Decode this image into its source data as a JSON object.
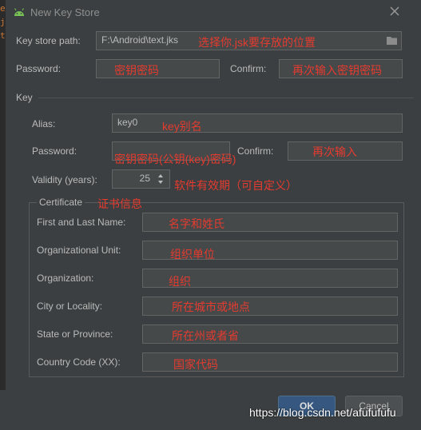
{
  "window": {
    "title": "New Key Store"
  },
  "editor": {
    "snippet": "e\nji\nt"
  },
  "keystore": {
    "path_label": "Key store path:",
    "path_value": "F:\\Android\\text.jks",
    "path_note": "选择你.jsk要存放的位置",
    "password_label": "Password:",
    "password_note": "密钥密码",
    "confirm_label": "Confirm:",
    "confirm_note": "再次输入密钥密码"
  },
  "key": {
    "section_label": "Key",
    "alias_label": "Alias:",
    "alias_value": "key0",
    "alias_note": "key别名",
    "password_label": "Password:",
    "password_note": "密钥密码(公钥(key)密码)",
    "confirm_label": "Confirm:",
    "confirm_note": "再次输入",
    "validity_label": "Validity (years):",
    "validity_value": "25",
    "validity_note": "软件有效期（可自定义）"
  },
  "certificate": {
    "section_label": "Certificate",
    "section_note": "证书信息",
    "fields": [
      {
        "label": "First and Last Name:",
        "note": "名字和姓氏"
      },
      {
        "label": "Organizational Unit:",
        "note": "组织单位"
      },
      {
        "label": "Organization:",
        "note": "组织"
      },
      {
        "label": "City or Locality:",
        "note": "所在城市或地点"
      },
      {
        "label": "State or Province:",
        "note": "所在州或者省"
      },
      {
        "label": "Country Code (XX):",
        "note": "国家代码"
      }
    ]
  },
  "buttons": {
    "ok": "OK",
    "cancel": "Cancel"
  },
  "watermark": "https://blog.csdn.net/afufufufu"
}
